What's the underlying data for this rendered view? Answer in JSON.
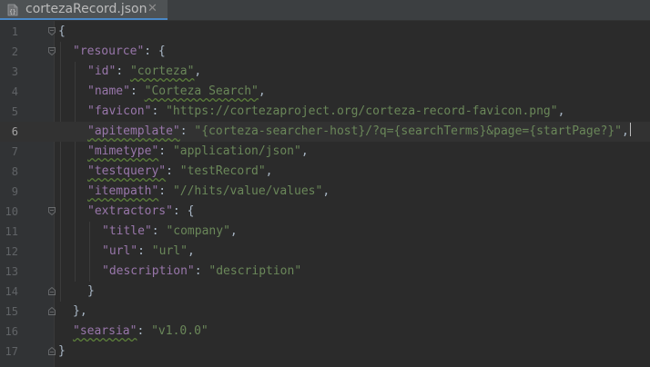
{
  "tab": {
    "label": "cortezaRecord.json",
    "icon": "json-file-icon",
    "close_glyph": "✕"
  },
  "colors": {
    "background": "#2b2b2b",
    "key": "#9876aa",
    "string": "#6a8759",
    "punctuation": "#a9b7c6",
    "line_number": "#606366",
    "tab_underline": "#4a88c7"
  },
  "editor": {
    "current_line": 6,
    "lines": [
      {
        "n": "1",
        "indent": 0,
        "tokens": [
          {
            "t": "{",
            "c": "p"
          }
        ]
      },
      {
        "n": "2",
        "indent": 1,
        "tokens": [
          {
            "t": "\"resource\"",
            "c": "k"
          },
          {
            "t": ": {",
            "c": "p"
          }
        ]
      },
      {
        "n": "3",
        "indent": 2,
        "tokens": [
          {
            "t": "\"id\"",
            "c": "k"
          },
          {
            "t": ": ",
            "c": "p"
          },
          {
            "t": "\"corteza\"",
            "c": "s",
            "sq": true
          },
          {
            "t": ",",
            "c": "p"
          }
        ]
      },
      {
        "n": "4",
        "indent": 2,
        "tokens": [
          {
            "t": "\"name\"",
            "c": "k"
          },
          {
            "t": ": ",
            "c": "p"
          },
          {
            "t": "\"Corteza Search\"",
            "c": "s",
            "sq": true
          },
          {
            "t": ",",
            "c": "p"
          }
        ]
      },
      {
        "n": "5",
        "indent": 2,
        "tokens": [
          {
            "t": "\"favicon\"",
            "c": "k"
          },
          {
            "t": ": ",
            "c": "p"
          },
          {
            "t": "\"https://cortezaproject.org/corteza-record-favicon.png\"",
            "c": "s"
          },
          {
            "t": ",",
            "c": "p"
          }
        ]
      },
      {
        "n": "6",
        "indent": 2,
        "tokens": [
          {
            "t": "\"apitemplate\"",
            "c": "k",
            "sq": true
          },
          {
            "t": ": ",
            "c": "p"
          },
          {
            "t": "\"{corteza-searcher-host}/?q={searchTerms}&page={startPage?}\"",
            "c": "s"
          },
          {
            "t": ",",
            "c": "p"
          }
        ]
      },
      {
        "n": "7",
        "indent": 2,
        "tokens": [
          {
            "t": "\"mimetype\"",
            "c": "k",
            "sq": true
          },
          {
            "t": ": ",
            "c": "p"
          },
          {
            "t": "\"application/json\"",
            "c": "s"
          },
          {
            "t": ",",
            "c": "p"
          }
        ]
      },
      {
        "n": "8",
        "indent": 2,
        "tokens": [
          {
            "t": "\"testquery\"",
            "c": "k",
            "sq": true
          },
          {
            "t": ": ",
            "c": "p"
          },
          {
            "t": "\"testRecord\"",
            "c": "s"
          },
          {
            "t": ",",
            "c": "p"
          }
        ]
      },
      {
        "n": "9",
        "indent": 2,
        "tokens": [
          {
            "t": "\"itempath\"",
            "c": "k",
            "sq": true
          },
          {
            "t": ": ",
            "c": "p"
          },
          {
            "t": "\"//hits/value/values\"",
            "c": "s"
          },
          {
            "t": ",",
            "c": "p"
          }
        ]
      },
      {
        "n": "10",
        "indent": 2,
        "tokens": [
          {
            "t": "\"extractors\"",
            "c": "k"
          },
          {
            "t": ": {",
            "c": "p"
          }
        ]
      },
      {
        "n": "11",
        "indent": 3,
        "tokens": [
          {
            "t": "\"title\"",
            "c": "k"
          },
          {
            "t": ": ",
            "c": "p"
          },
          {
            "t": "\"company\"",
            "c": "s"
          },
          {
            "t": ",",
            "c": "p"
          }
        ]
      },
      {
        "n": "12",
        "indent": 3,
        "tokens": [
          {
            "t": "\"url\"",
            "c": "k"
          },
          {
            "t": ": ",
            "c": "p"
          },
          {
            "t": "\"url\"",
            "c": "s"
          },
          {
            "t": ",",
            "c": "p"
          }
        ]
      },
      {
        "n": "13",
        "indent": 3,
        "tokens": [
          {
            "t": "\"description\"",
            "c": "k"
          },
          {
            "t": ": ",
            "c": "p"
          },
          {
            "t": "\"description\"",
            "c": "s"
          }
        ]
      },
      {
        "n": "14",
        "indent": 2,
        "tokens": [
          {
            "t": "}",
            "c": "p"
          }
        ]
      },
      {
        "n": "15",
        "indent": 1,
        "tokens": [
          {
            "t": "},",
            "c": "p"
          }
        ]
      },
      {
        "n": "16",
        "indent": 1,
        "tokens": [
          {
            "t": "\"searsia\"",
            "c": "k",
            "sq": true
          },
          {
            "t": ": ",
            "c": "p"
          },
          {
            "t": "\"v1.0.0\"",
            "c": "s"
          }
        ]
      },
      {
        "n": "17",
        "indent": 0,
        "tokens": [
          {
            "t": "}",
            "c": "p"
          }
        ]
      }
    ]
  }
}
